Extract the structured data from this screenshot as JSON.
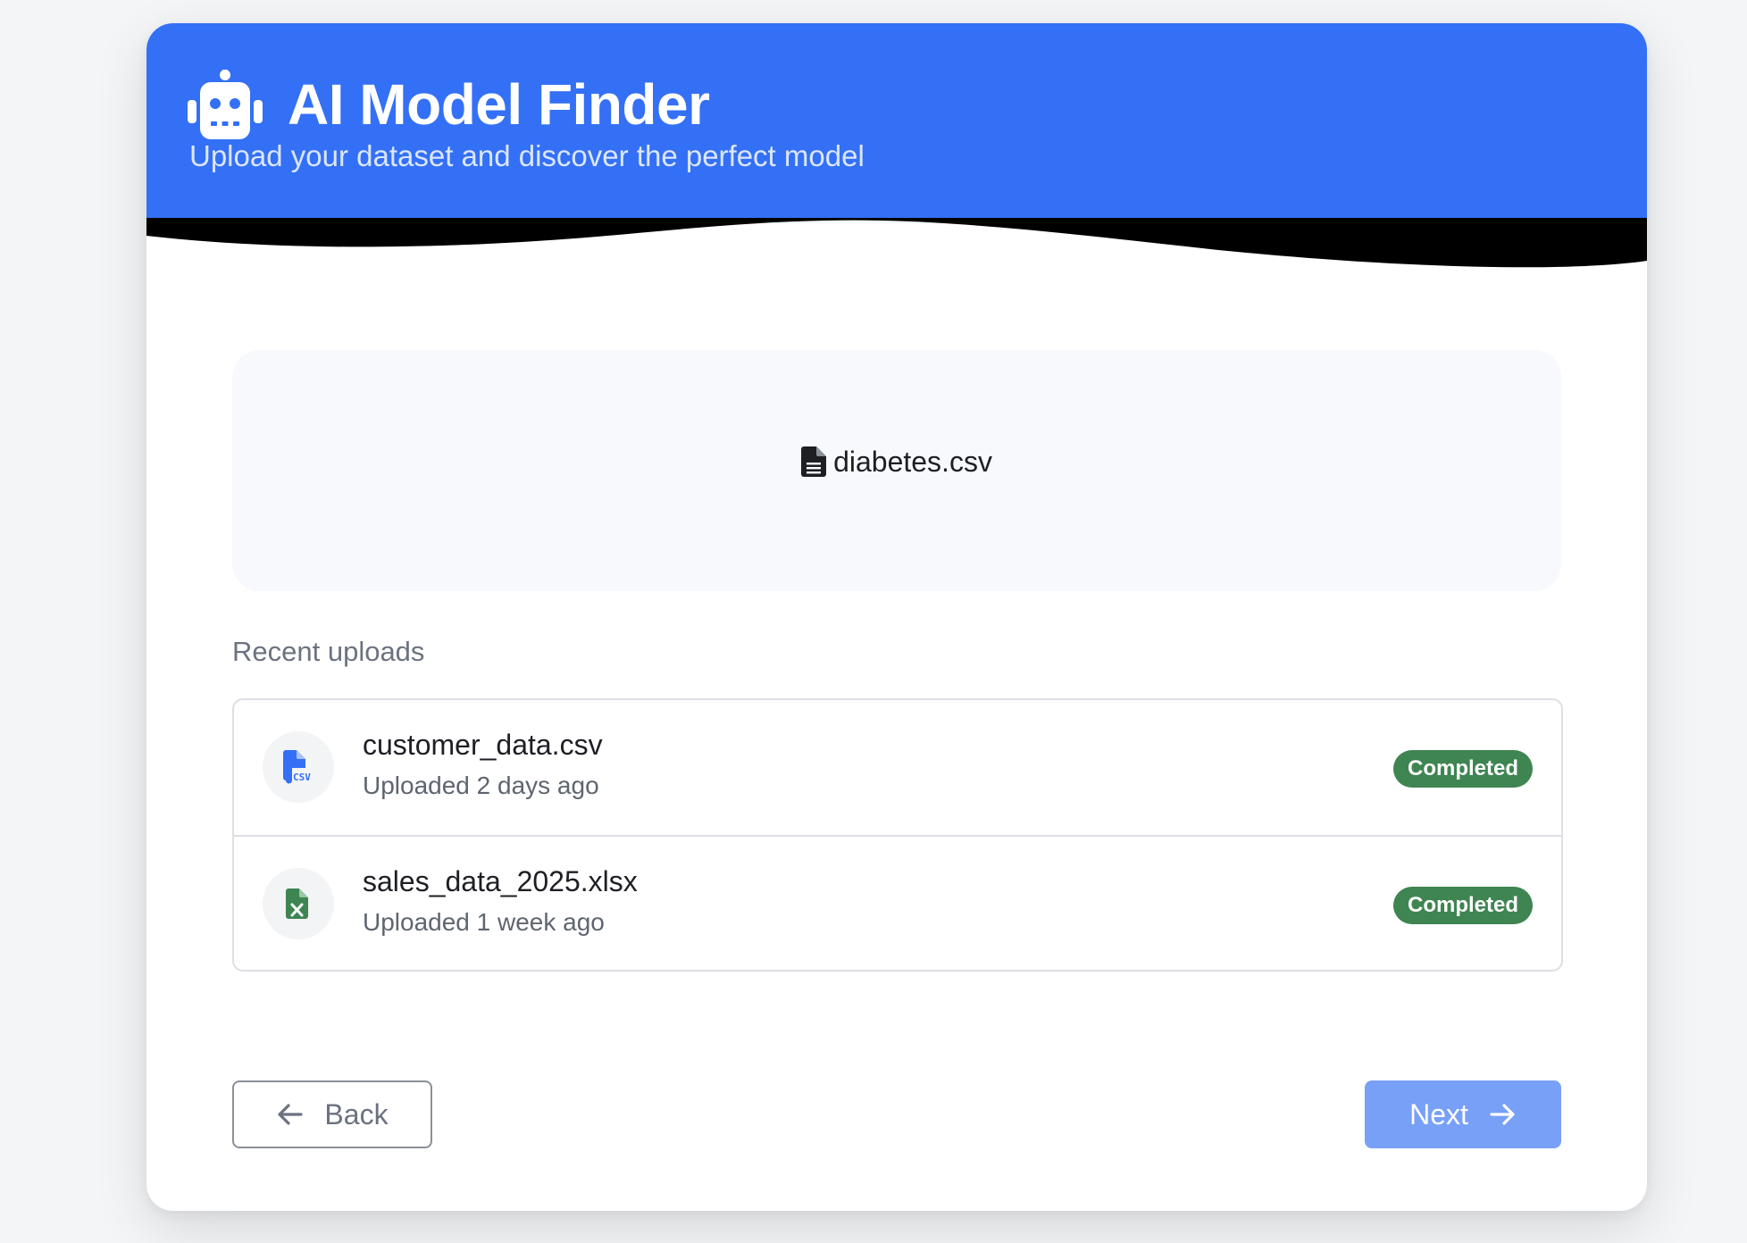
{
  "header": {
    "title": "AI Model Finder",
    "subtitle": "Upload your dataset and discover the perfect model",
    "logo_icon": "robot-icon",
    "background": "#3470f5"
  },
  "dropzone": {
    "file_icon": "file-icon",
    "file_name": "diabetes.csv"
  },
  "recent": {
    "label": "Recent uploads",
    "items": [
      {
        "name": "customer_data.csv",
        "uploaded": "Uploaded 2 days ago",
        "status": "Completed",
        "icon": "csv-file-icon",
        "icon_color": "#3470f5"
      },
      {
        "name": "sales_data_2025.xlsx",
        "uploaded": "Uploaded 1 week ago",
        "status": "Completed",
        "icon": "excel-file-icon",
        "icon_color": "#3e8552"
      }
    ],
    "status_color": "#3e8552"
  },
  "nav": {
    "back_label": "Back",
    "back_icon": "arrow-left-icon",
    "next_label": "Next",
    "next_icon": "arrow-right-icon",
    "next_color": "#78a0f7"
  }
}
